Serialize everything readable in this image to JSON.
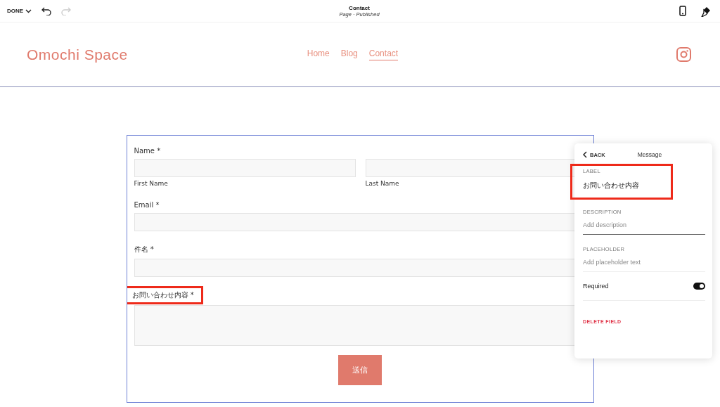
{
  "toolbar": {
    "done": "DONE",
    "title": "Contact",
    "subtitle": "Page · Published"
  },
  "site": {
    "logo": "Omochi Space",
    "nav": [
      {
        "label": "Home",
        "selected": false
      },
      {
        "label": "Blog",
        "selected": false
      },
      {
        "label": "Contact",
        "selected": true
      }
    ]
  },
  "form": {
    "fields": [
      {
        "kind": "name",
        "label": "Name *",
        "sublabels": [
          "First Name",
          "Last Name"
        ],
        "highlighted": false
      },
      {
        "kind": "text",
        "label": "Email *",
        "highlighted": false
      },
      {
        "kind": "text",
        "label": "件名 *",
        "highlighted": false
      },
      {
        "kind": "textarea",
        "label": "お問い合わせ内容 *",
        "highlighted": true
      }
    ],
    "submit": "送信"
  },
  "panel": {
    "back": "BACK",
    "title": "Message",
    "label": {
      "caption": "LABEL",
      "value": "お問い合わせ内容",
      "highlighted": true
    },
    "description": {
      "caption": "DESCRIPTION",
      "placeholder": "Add description",
      "focused": true
    },
    "placeholder": {
      "caption": "PLACEHOLDER",
      "placeholder": "Add placeholder text",
      "focused": false
    },
    "required": {
      "label": "Required",
      "on": true
    },
    "delete": "DELETE FIELD"
  }
}
